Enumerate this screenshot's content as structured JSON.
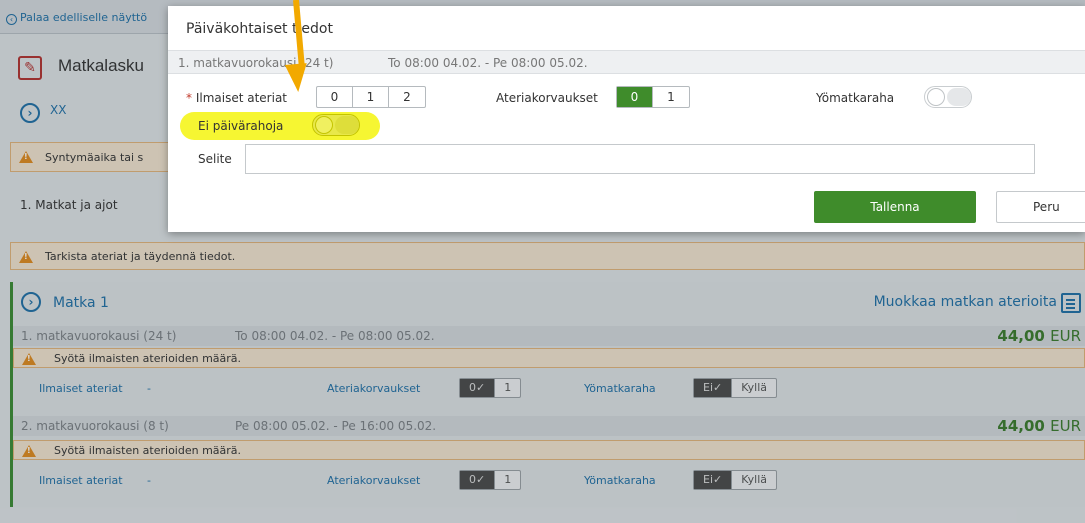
{
  "background": {
    "back_link": "Palaa edelliselle näyttö",
    "header_title": "Matkalasku",
    "traveler": "XX",
    "birthdate_warning": "Syntymäaika tai s",
    "section_label": "1. Matkat ja ajot",
    "meals_warning": "Tarkista ateriat ja täydennä tiedot.",
    "trip": {
      "title": "Matka 1",
      "edit_meals_label": "Muokkaa matkan aterioita",
      "days": [
        {
          "label": "1. matkavuorokausi (24 t)",
          "range": "To 08:00 04.02.  -  Pe 08:00 05.02.",
          "amount": "44,00",
          "currency": "EUR",
          "warning": "Syötä ilmaisten aterioiden määrä.",
          "free_meals_label": "Ilmaiset ateriat",
          "free_meals_value": "-",
          "meal_comp_label": "Ateriakorvaukset",
          "meal_comp_options": [
            "0✓",
            "1"
          ],
          "night_label": "Yömatkaraha",
          "night_options": [
            "Ei✓",
            "Kyllä"
          ]
        },
        {
          "label": "2. matkavuorokausi (8 t)",
          "range": "Pe 08:00 05.02.  -  Pe 16:00 05.02.",
          "amount": "44,00",
          "currency": "EUR",
          "warning": "Syötä ilmaisten aterioiden määrä.",
          "free_meals_label": "Ilmaiset ateriat",
          "free_meals_value": "-",
          "meal_comp_label": "Ateriakorvaukset",
          "meal_comp_options": [
            "0✓",
            "1"
          ],
          "night_label": "Yömatkaraha",
          "night_options": [
            "Ei✓",
            "Kyllä"
          ]
        }
      ]
    }
  },
  "modal": {
    "title": "Päiväkohtaiset tiedot",
    "day_label": "1. matkavuorokausi (24 t)",
    "day_range": "To 08:00 04.02.  -  Pe 08:00 05.02.",
    "required_mark": "*",
    "free_meals_label": "Ilmaiset ateriat",
    "free_meals_options": [
      "0",
      "1",
      "2"
    ],
    "meal_comp_label": "Ateriakorvaukset",
    "meal_comp_options": [
      "0",
      "1"
    ],
    "meal_comp_selected": "0",
    "night_label": "Yömatkaraha",
    "no_allowance_label": "Ei päivärahoja",
    "selite_label": "Selite",
    "selite_value": "",
    "save_label": "Tallenna",
    "cancel_label": "Peru"
  },
  "colors": {
    "accent_green": "#3f8c2b",
    "link_blue": "#1f6fa6",
    "warning_orange": "#e08a1e",
    "highlight_yellow": "#f4f50e",
    "annotation_arrow": "#f2a900"
  }
}
